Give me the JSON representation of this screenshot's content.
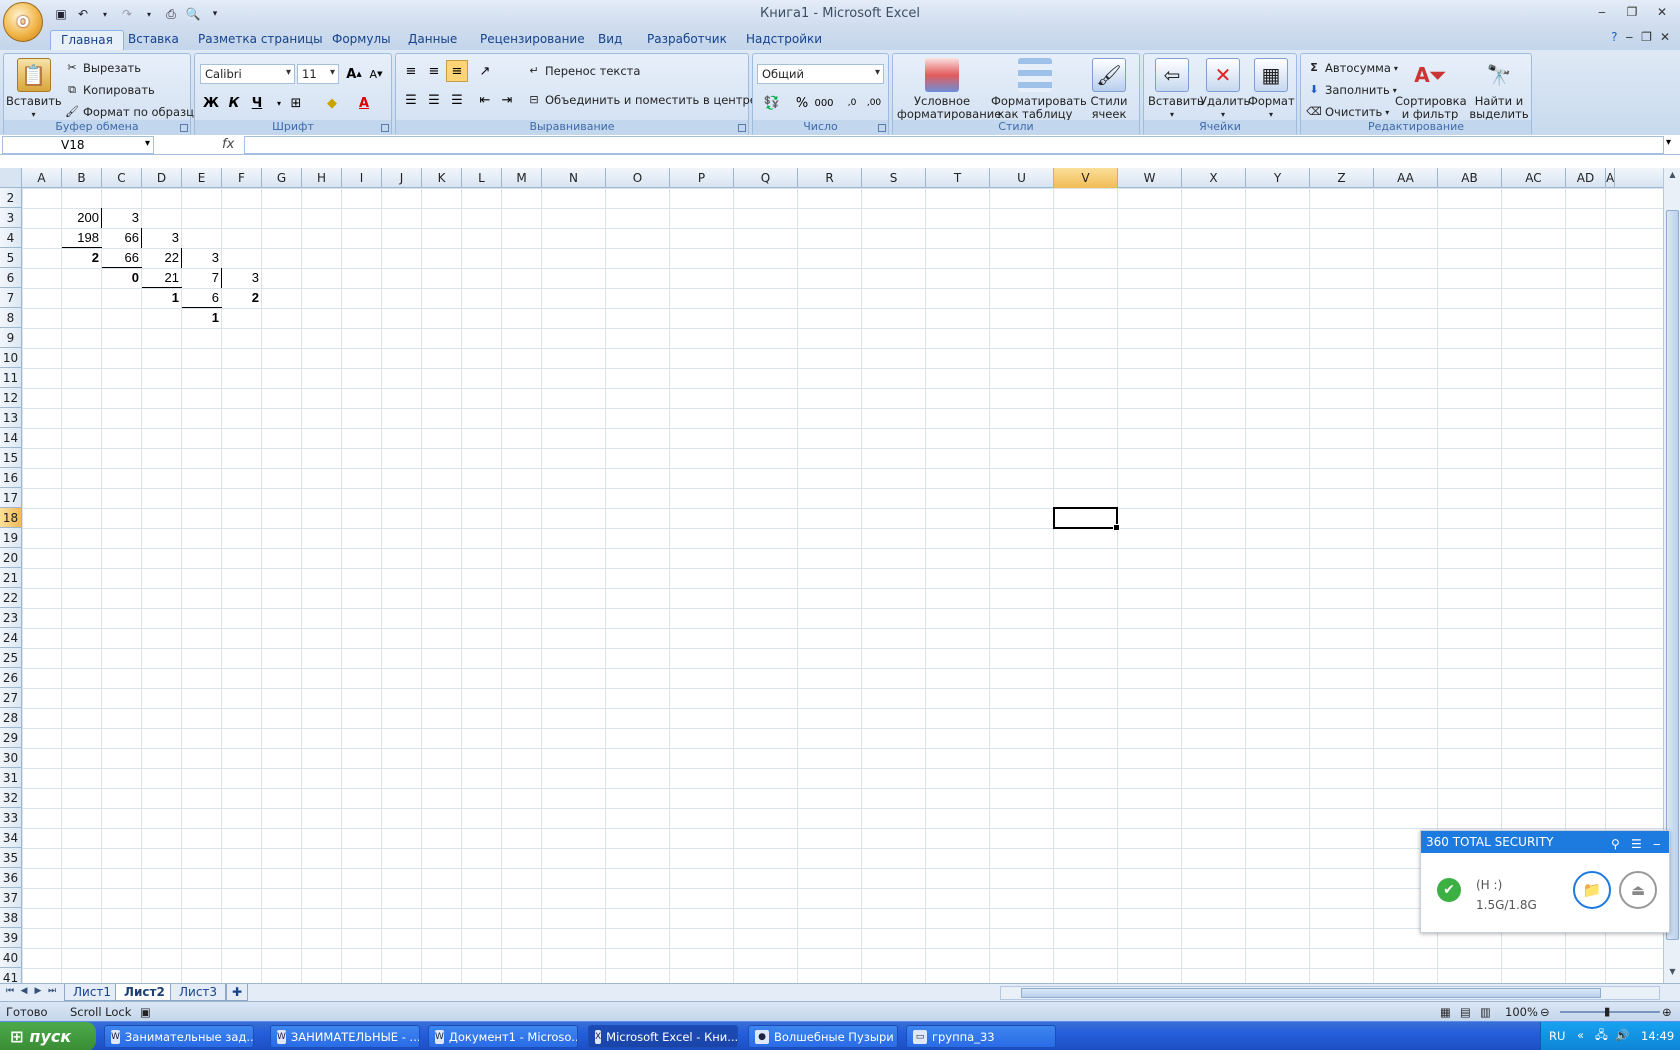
{
  "window": {
    "title": "Книга1 - Microsoft Excel",
    "office_button": "O",
    "controls": [
      "‒",
      "❐",
      "✕"
    ]
  },
  "ribbon_tabs": [
    "Главная",
    "Вставка",
    "Разметка страницы",
    "Формулы",
    "Данные",
    "Рецензирование",
    "Вид",
    "Разработчик",
    "Надстройки"
  ],
  "active_tab": "Главная",
  "clipboard": {
    "label": "Буфер обмена",
    "paste": "Вставить",
    "cut": "Вырезать",
    "copy": "Копировать",
    "format_painter": "Формат по образцу"
  },
  "font": {
    "label": "Шрифт",
    "family": "Calibri",
    "size": "11",
    "bold": "Ж",
    "italic": "К",
    "underline": "Ч"
  },
  "alignment": {
    "label": "Выравнивание",
    "wrap": "Перенос текста",
    "merge": "Объединить и поместить в центре"
  },
  "number": {
    "label": "Число",
    "format": "Общий",
    "percent": "%",
    "thousands": "000",
    "inc_decimal": ",0",
    "dec_decimal": ",00"
  },
  "styles": {
    "label": "Стили",
    "conditional": [
      "Условное",
      "форматирование"
    ],
    "as_table": [
      "Форматировать",
      "как таблицу"
    ],
    "cell_styles": [
      "Стили",
      "ячеек"
    ]
  },
  "cells": {
    "label": "Ячейки",
    "insert": "Вставить",
    "delete": "Удалить",
    "format": "Формат"
  },
  "editing": {
    "label": "Редактирование",
    "autosum": "Автосумма",
    "fill": "Заполнить",
    "clear": "Очистить",
    "sort": [
      "Сортировка",
      "и фильтр"
    ],
    "find": [
      "Найти и",
      "выделить"
    ]
  },
  "formula_bar": {
    "name_box": "V18",
    "fx": "fx",
    "value": ""
  },
  "columns": [
    "A",
    "B",
    "C",
    "D",
    "E",
    "F",
    "G",
    "H",
    "I",
    "J",
    "K",
    "L",
    "M",
    "N",
    "O",
    "P",
    "Q",
    "R",
    "S",
    "T",
    "U",
    "V",
    "W",
    "X",
    "Y",
    "Z",
    "AA",
    "AB",
    "AC",
    "AD",
    "A"
  ],
  "rows": [
    "2",
    "3",
    "4",
    "5",
    "6",
    "7",
    "8",
    "9",
    "10",
    "11",
    "12",
    "13",
    "14",
    "15",
    "16",
    "17",
    "18",
    "19",
    "20",
    "21",
    "22",
    "23",
    "24",
    "25",
    "26",
    "27",
    "28",
    "29",
    "30",
    "31",
    "32",
    "33",
    "34",
    "35",
    "36",
    "37",
    "38",
    "39",
    "40",
    "41"
  ],
  "selected_column": "V",
  "selected_row": "18",
  "cell_values": [
    {
      "ref": "B3",
      "value": "200",
      "bold": false
    },
    {
      "ref": "C3",
      "value": "3",
      "bold": false
    },
    {
      "ref": "B4",
      "value": "198",
      "bold": false
    },
    {
      "ref": "C4",
      "value": "66",
      "bold": false
    },
    {
      "ref": "D4",
      "value": "3",
      "bold": false
    },
    {
      "ref": "B5",
      "value": "2",
      "bold": true
    },
    {
      "ref": "C5",
      "value": "66",
      "bold": false
    },
    {
      "ref": "D5",
      "value": "22",
      "bold": false
    },
    {
      "ref": "E5",
      "value": "3",
      "bold": false
    },
    {
      "ref": "C6",
      "value": "0",
      "bold": true
    },
    {
      "ref": "D6",
      "value": "21",
      "bold": false
    },
    {
      "ref": "E6",
      "value": "7",
      "bold": false
    },
    {
      "ref": "F6",
      "value": "3",
      "bold": false
    },
    {
      "ref": "D7",
      "value": "1",
      "bold": true
    },
    {
      "ref": "E7",
      "value": "6",
      "bold": false
    },
    {
      "ref": "F7",
      "value": "2",
      "bold": true
    },
    {
      "ref": "E8",
      "value": "1",
      "bold": true
    }
  ],
  "sheet_tabs": [
    "Лист1",
    "Лист2",
    "Лист3"
  ],
  "active_sheet": "Лист2",
  "status": {
    "ready": "Готово",
    "scroll_lock": "Scroll Lock",
    "zoom": "100%"
  },
  "taskbar": {
    "start": "пуск",
    "items": [
      {
        "label": "Занимательные зад...",
        "icon": "word-icon"
      },
      {
        "label": "ЗАНИМАТЕЛЬНЫЕ - ...",
        "icon": "word-icon"
      },
      {
        "label": "Документ1 - Microso...",
        "icon": "word-icon"
      },
      {
        "label": "Microsoft Excel - Кни...",
        "icon": "excel-icon"
      },
      {
        "label": "Волшебные Пузыри",
        "icon": "game-icon"
      },
      {
        "label": "группа_33",
        "icon": "folder-icon"
      }
    ],
    "active_item": "Microsoft Excel - Кни...",
    "lang": "RU",
    "clock": "14:49"
  },
  "security_widget": {
    "title": "360 TOTAL SECURITY",
    "drive": "(H :)",
    "usage": "1.5G/1.8G"
  }
}
